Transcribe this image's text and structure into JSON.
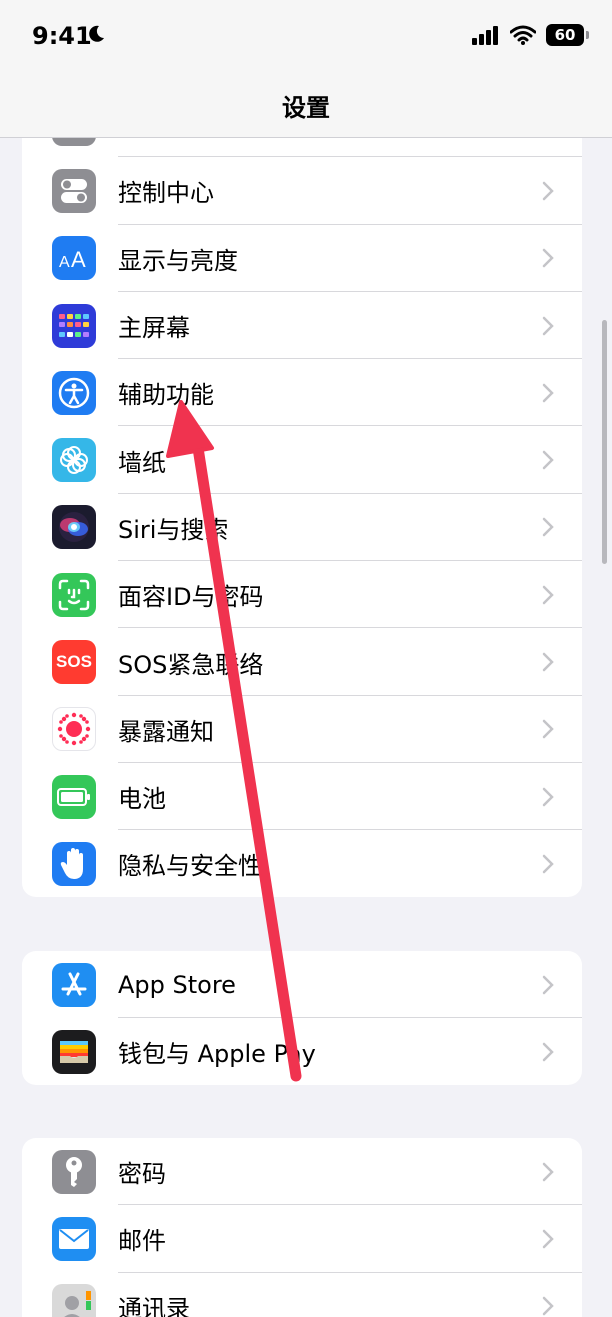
{
  "status": {
    "time": "9:41",
    "battery": "60"
  },
  "nav": {
    "title": "设置"
  },
  "group1": {
    "items": [
      {
        "label": "",
        "icon": "cellular-icon",
        "color": "#8e8e93"
      },
      {
        "label": "控制中心",
        "icon": "control-center-icon",
        "color": "#8e8e93"
      },
      {
        "label": "显示与亮度",
        "icon": "display-brightness-icon",
        "color": "#1f7cf2"
      },
      {
        "label": "主屏幕",
        "icon": "home-screen-icon",
        "color": "#2e3bd8"
      },
      {
        "label": "辅助功能",
        "icon": "accessibility-icon",
        "color": "#1f7cf2"
      },
      {
        "label": "墙纸",
        "icon": "wallpaper-icon",
        "color": "#35b7e8"
      },
      {
        "label": "Siri与搜索",
        "icon": "siri-icon",
        "color": "#1b1b2e"
      },
      {
        "label": "面容ID与密码",
        "icon": "face-id-icon",
        "color": "#34c759"
      },
      {
        "label": "SOS紧急联络",
        "icon": "sos-icon",
        "color": "#ff3b30",
        "icon_text": "SOS"
      },
      {
        "label": "暴露通知",
        "icon": "exposure-notification-icon",
        "color": "#ffffff"
      },
      {
        "label": "电池",
        "icon": "battery-icon",
        "color": "#34c759"
      },
      {
        "label": "隐私与安全性",
        "icon": "privacy-hand-icon",
        "color": "#1f7cf2"
      }
    ]
  },
  "group2": {
    "items": [
      {
        "label": "App Store",
        "icon": "app-store-icon",
        "color": "#1f8ef2"
      },
      {
        "label": "钱包与 Apple Pay",
        "icon": "wallet-icon",
        "color": "#1c1c1e"
      }
    ]
  },
  "group3": {
    "items": [
      {
        "label": "密码",
        "icon": "key-icon",
        "color": "#8e8e93"
      },
      {
        "label": "邮件",
        "icon": "mail-icon",
        "color": "#1f8ef2"
      },
      {
        "label": "通讯录",
        "icon": "contacts-icon",
        "color": "#d9d9d9"
      }
    ]
  },
  "colors": {
    "arrow": "#f0334f",
    "background": "#f2f2f7"
  }
}
